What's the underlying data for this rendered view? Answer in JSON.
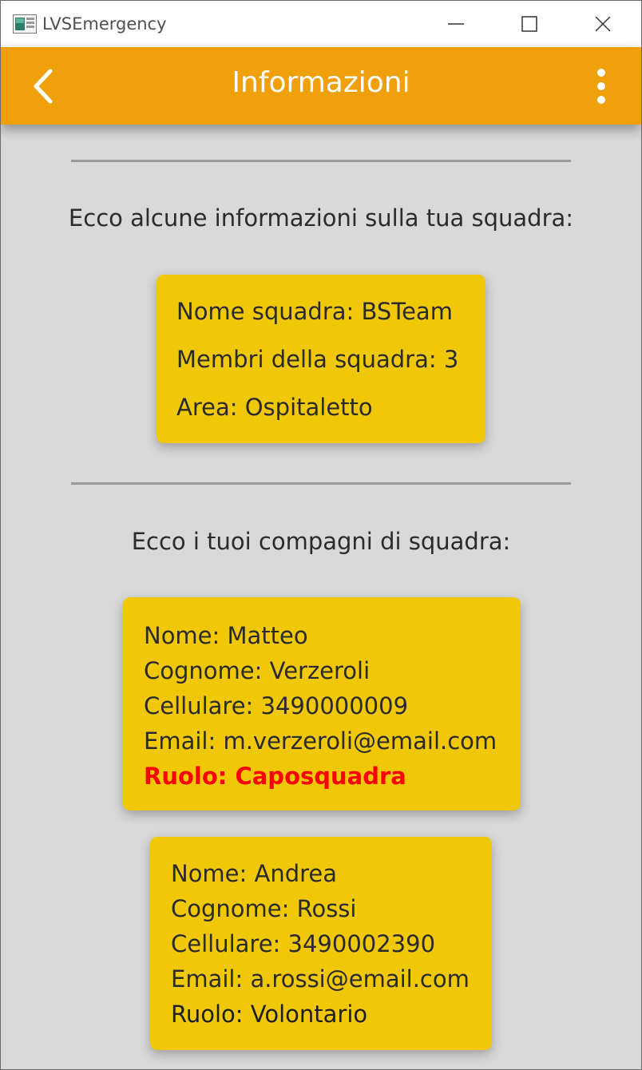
{
  "window": {
    "title": "LVSEmergency",
    "icon": "app-window-icon"
  },
  "appbar": {
    "title": "Informazioni",
    "color": "#f0a00a",
    "back_icon": "chevron-left-icon",
    "menu_icon": "more-vertical-icon"
  },
  "team_section": {
    "heading": "Ecco alcune informazioni sulla tua squadra:",
    "team_name": "Nome squadra: BSTeam",
    "members_count": "Membri della squadra: 3",
    "area": "Area: Ospitaletto"
  },
  "members_section": {
    "heading": "Ecco i tuoi compagni di squadra:",
    "members": [
      {
        "name": "Nome: Matteo",
        "surname": "Cognome: Verzeroli",
        "phone": "Cellulare: 3490000009",
        "email": "Email: m.verzeroli@email.com",
        "role": "Ruolo: Caposquadra",
        "role_color": "#ff0000"
      },
      {
        "name": "Nome: Andrea",
        "surname": "Cognome: Rossi",
        "phone": "Cellulare: 3490002390",
        "email": "Email: a.rossi@email.com",
        "role": "Ruolo: Volontario"
      }
    ]
  },
  "colors": {
    "card": "#f0c808",
    "background": "#d9d9d9"
  }
}
